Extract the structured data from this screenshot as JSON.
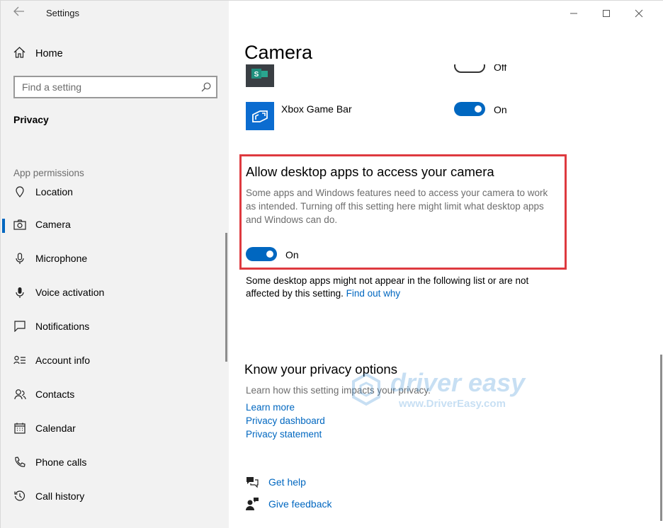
{
  "window": {
    "title": "Settings"
  },
  "sidebar": {
    "home_label": "Home",
    "search": {
      "placeholder": "Find a setting"
    },
    "section_title": "Privacy",
    "group_label": "App permissions",
    "items": [
      {
        "label": "Location",
        "icon": "location-icon"
      },
      {
        "label": "Camera",
        "icon": "camera-icon",
        "active": true
      },
      {
        "label": "Microphone",
        "icon": "microphone-icon"
      },
      {
        "label": "Voice activation",
        "icon": "voice-activation-icon"
      },
      {
        "label": "Notifications",
        "icon": "notifications-icon"
      },
      {
        "label": "Account info",
        "icon": "account-info-icon"
      },
      {
        "label": "Contacts",
        "icon": "contacts-icon"
      },
      {
        "label": "Calendar",
        "icon": "calendar-icon"
      },
      {
        "label": "Phone calls",
        "icon": "phone-icon"
      },
      {
        "label": "Call history",
        "icon": "call-history-icon"
      }
    ]
  },
  "main": {
    "page_title": "Camera",
    "apps": [
      {
        "name": "",
        "state": "Off",
        "icon": "sway-app-icon"
      },
      {
        "name": "Xbox Game Bar",
        "state": "On",
        "icon": "xbox-game-bar-icon"
      }
    ],
    "desktop_apps": {
      "heading": "Allow desktop apps to access your camera",
      "description_lines": [
        "Some apps and Windows features need to access your camera to work",
        "as intended. Turning off this setting here might limit what desktop apps",
        "and Windows can do."
      ],
      "toggle_state": "On",
      "note_line1": "Some desktop apps might not appear in the following list or are not",
      "note_line2": "affected by this setting.",
      "note_link": "Find out why"
    },
    "privacy_options": {
      "heading": "Know your privacy options",
      "description": "Learn how this setting impacts your privacy.",
      "links": [
        "Learn more",
        "Privacy dashboard",
        "Privacy statement"
      ]
    },
    "help": {
      "get_help": "Get help",
      "give_feedback": "Give feedback"
    }
  },
  "watermark": {
    "brand": "driver easy",
    "url": "www.DriverEasy.com"
  },
  "colors": {
    "accent": "#0067c0",
    "highlight": "#de3a3f",
    "sidebar_bg": "#f2f2f2"
  }
}
